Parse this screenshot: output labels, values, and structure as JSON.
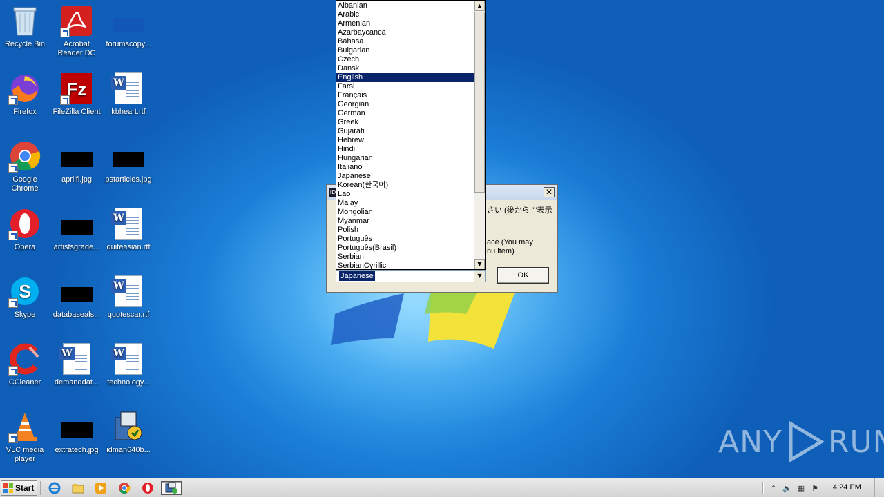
{
  "desktop_icons": [
    {
      "label": "Recycle Bin"
    },
    {
      "label": "Acrobat Reader DC"
    },
    {
      "label": "forumscopy..."
    },
    {
      "label": "Firefox"
    },
    {
      "label": "FileZilla Client"
    },
    {
      "label": "kbheart.rtf"
    },
    {
      "label": "Google Chrome"
    },
    {
      "label": "aprilfl.jpg"
    },
    {
      "label": "pstarticles.jpg"
    },
    {
      "label": "Opera"
    },
    {
      "label": "artistsgrade..."
    },
    {
      "label": "quiteasian.rtf"
    },
    {
      "label": "Skype"
    },
    {
      "label": "databaseals..."
    },
    {
      "label": "quotescar.rtf"
    },
    {
      "label": "CCleaner"
    },
    {
      "label": "demanddat..."
    },
    {
      "label": "technology..."
    },
    {
      "label": "VLC media player"
    },
    {
      "label": "extratech.jpg"
    },
    {
      "label": "idman640b..."
    }
  ],
  "language_list": {
    "items": [
      "Albanian",
      "Arabic",
      "Armenian",
      "Azarbaycanca",
      "Bahasa",
      "Bulgarian",
      "Czech",
      "Dansk",
      "English",
      "Farsi",
      "Français",
      "Georgian",
      "German",
      "Greek",
      "Gujarati",
      "Hebrew",
      "Hindi",
      "Hungarian",
      "Italiano",
      "Japanese",
      "Korean(한국어)",
      "Lao",
      "Malay",
      "Mongolian",
      "Myanmar",
      "Polish",
      "Português",
      "Português(Brasil)",
      "Serbian",
      "SerbianCyrillic"
    ],
    "highlighted": "English",
    "combo_value": "Japanese"
  },
  "dialog": {
    "icon_text": "ID",
    "close_glyph": "✕",
    "message_line1": "さい (後から \"\"表示",
    "message_line2": "ace (You may",
    "message_line3": "nu item)",
    "ok_label": "OK"
  },
  "taskbar": {
    "start_label": "Start",
    "clock": "4:24 PM"
  },
  "watermark": {
    "left": "ANY",
    "right": "RUN"
  },
  "colors": {
    "selection": "#0a246a",
    "desktop_blue": "#1b7fd8"
  }
}
